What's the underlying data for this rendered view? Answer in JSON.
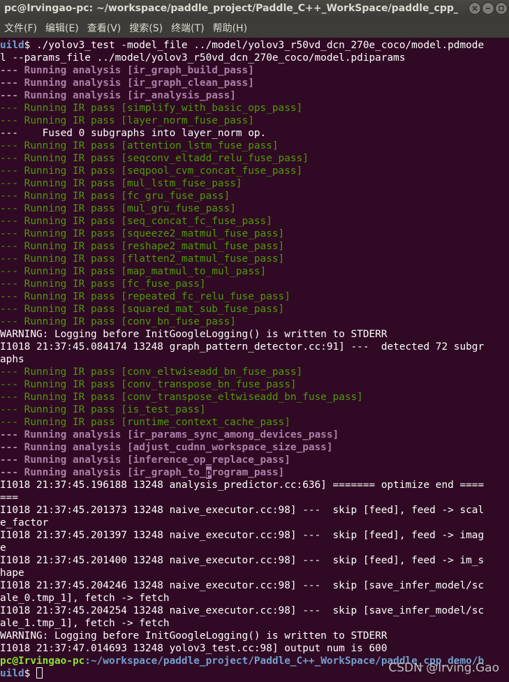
{
  "window": {
    "title": "pc@Irvingao-pc: ~/workspace/paddle_project/Paddle_C++_WorkSpace/paddle_cpp_demo/b…"
  },
  "menu": [
    "文件(F)",
    "编辑(E)",
    "查看(V)",
    "搜索(S)",
    "终端(T)",
    "帮助(H)"
  ],
  "terminal": {
    "lines": [
      {
        "style": "prompt-tail",
        "a": "uild",
        "b": "$ ./yolov3_test -model_file ../model/yolov3_r50vd_dcn_270e_coco/model.pdmode"
      },
      {
        "style": "plain",
        "text": "l --params_file ../model/yolov3_r50vd_dcn_270e_coco/model.pdiparams"
      },
      {
        "style": "analysis",
        "text": "--- Running analysis [ir_graph_build_pass]"
      },
      {
        "style": "analysis",
        "text": "--- Running analysis [ir_graph_clean_pass]"
      },
      {
        "style": "analysis",
        "text": "--- Running analysis [ir_analysis_pass]"
      },
      {
        "style": "ir",
        "text": "--- Running IR pass [simplify_with_basic_ops_pass]"
      },
      {
        "style": "ir",
        "text": "--- Running IR pass [layer_norm_fuse_pass]"
      },
      {
        "style": "plain",
        "text": "---    Fused 0 subgraphs into layer_norm op."
      },
      {
        "style": "ir",
        "text": "--- Running IR pass [attention_lstm_fuse_pass]"
      },
      {
        "style": "ir",
        "text": "--- Running IR pass [seqconv_eltadd_relu_fuse_pass]"
      },
      {
        "style": "ir",
        "text": "--- Running IR pass [seqpool_cvm_concat_fuse_pass]"
      },
      {
        "style": "ir",
        "text": "--- Running IR pass [mul_lstm_fuse_pass]"
      },
      {
        "style": "ir",
        "text": "--- Running IR pass [fc_gru_fuse_pass]"
      },
      {
        "style": "ir",
        "text": "--- Running IR pass [mul_gru_fuse_pass]"
      },
      {
        "style": "ir",
        "text": "--- Running IR pass [seq_concat_fc_fuse_pass]"
      },
      {
        "style": "ir",
        "text": "--- Running IR pass [squeeze2_matmul_fuse_pass]"
      },
      {
        "style": "ir",
        "text": "--- Running IR pass [reshape2_matmul_fuse_pass]"
      },
      {
        "style": "ir",
        "text": "--- Running IR pass [flatten2_matmul_fuse_pass]"
      },
      {
        "style": "ir",
        "text": "--- Running IR pass [map_matmul_to_mul_pass]"
      },
      {
        "style": "ir",
        "text": "--- Running IR pass [fc_fuse_pass]"
      },
      {
        "style": "ir",
        "text": "--- Running IR pass [repeated_fc_relu_fuse_pass]"
      },
      {
        "style": "ir",
        "text": "--- Running IR pass [squared_mat_sub_fuse_pass]"
      },
      {
        "style": "ir",
        "text": "--- Running IR pass [conv_bn_fuse_pass]"
      },
      {
        "style": "plain",
        "text": "WARNING: Logging before InitGoogleLogging() is written to STDERR"
      },
      {
        "style": "plain",
        "text": "I1018 21:37:45.084174 13248 graph_pattern_detector.cc:91] ---  detected 72 subgr"
      },
      {
        "style": "plain",
        "text": "aphs"
      },
      {
        "style": "ir",
        "text": "--- Running IR pass [conv_eltwiseadd_bn_fuse_pass]"
      },
      {
        "style": "ir",
        "text": "--- Running IR pass [conv_transpose_bn_fuse_pass]"
      },
      {
        "style": "ir",
        "text": "--- Running IR pass [conv_transpose_eltwiseadd_bn_fuse_pass]"
      },
      {
        "style": "ir",
        "text": "--- Running IR pass [is_test_pass]"
      },
      {
        "style": "ir",
        "text": "--- Running IR pass [runtime_context_cache_pass]"
      },
      {
        "style": "analysis",
        "text": "--- Running analysis [ir_params_sync_among_devices_pass]"
      },
      {
        "style": "analysis",
        "text": "--- Running analysis [adjust_cudnn_workspace_size_pass]"
      },
      {
        "style": "analysis",
        "text": "--- Running analysis [inference_op_replace_pass]"
      },
      {
        "style": "analysis-cursor",
        "a": "--- Running analysis [ir_graph_to_",
        "b": "p",
        "c": "rogram_pass]"
      },
      {
        "style": "plain",
        "text": "I1018 21:37:45.196188 13248 analysis_predictor.cc:636] ======= optimize end ===="
      },
      {
        "style": "plain",
        "text": "==="
      },
      {
        "style": "plain",
        "text": "I1018 21:37:45.201373 13248 naive_executor.cc:98] ---  skip [feed], feed -> scal"
      },
      {
        "style": "plain",
        "text": "e_factor"
      },
      {
        "style": "plain",
        "text": "I1018 21:37:45.201397 13248 naive_executor.cc:98] ---  skip [feed], feed -> imag"
      },
      {
        "style": "plain",
        "text": "e"
      },
      {
        "style": "plain",
        "text": "I1018 21:37:45.201400 13248 naive_executor.cc:98] ---  skip [feed], feed -> im_s"
      },
      {
        "style": "plain",
        "text": "hape"
      },
      {
        "style": "plain",
        "text": "I1018 21:37:45.204246 13248 naive_executor.cc:98] ---  skip [save_infer_model/sc"
      },
      {
        "style": "plain",
        "text": "ale_0.tmp_1], fetch -> fetch"
      },
      {
        "style": "plain",
        "text": "I1018 21:37:45.204254 13248 naive_executor.cc:98] ---  skip [save_infer_model/sc"
      },
      {
        "style": "plain",
        "text": "ale_1.tmp_1], fetch -> fetch"
      },
      {
        "style": "plain",
        "text": "WARNING: Logging before InitGoogleLogging() is written to STDERR"
      },
      {
        "style": "plain",
        "text": "I1018 21:37:47.014693 13248 yolov3_test.cc:98] output num is 600"
      },
      {
        "style": "prompt",
        "a": "pc@Irvingao-pc",
        "b": ":~/workspace/paddle_project/Paddle_C++_WorkSpace/paddle_cpp_demo/b"
      },
      {
        "style": "prompt-cursor",
        "a": "uild",
        "b": "$ "
      }
    ]
  },
  "watermark": "CSDN @Irving.Gao",
  "colors": {
    "background": "#300a24",
    "analysis": "#ad7fa8",
    "ir_pass": "#4e9a06",
    "prompt_user": "#8ae234",
    "prompt_path": "#729fcf"
  }
}
